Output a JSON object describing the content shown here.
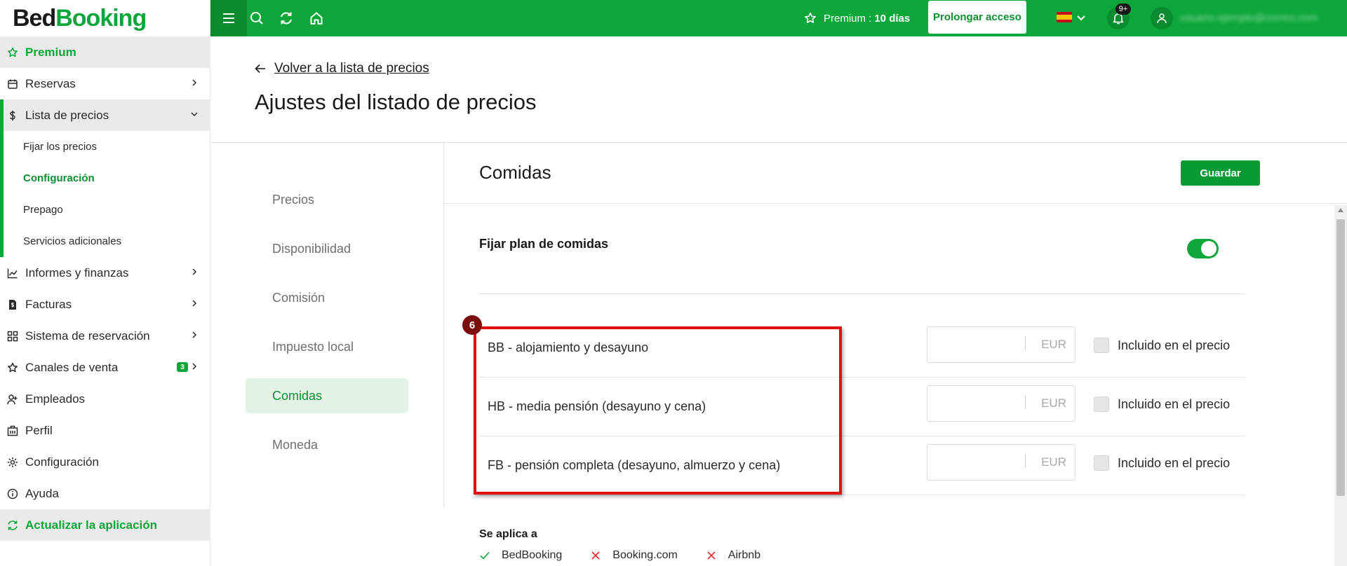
{
  "logo": {
    "part1": "Bed",
    "part2": "Booking"
  },
  "sidebar": {
    "premium": "Premium",
    "items": [
      {
        "label": "Reservas",
        "icon": "calendar-icon"
      },
      {
        "label": "Lista de precios",
        "icon": "dollar-icon"
      },
      {
        "label": "Informes y finanzas",
        "icon": "chart-icon"
      },
      {
        "label": "Facturas",
        "icon": "invoice-icon"
      },
      {
        "label": "Sistema de reservación",
        "icon": "grid-icon"
      },
      {
        "label": "Canales de venta",
        "icon": "star-icon",
        "badge": "3"
      },
      {
        "label": "Empleados",
        "icon": "user-plus-icon"
      },
      {
        "label": "Perfil",
        "icon": "building-icon"
      },
      {
        "label": "Configuración",
        "icon": "gear-icon"
      },
      {
        "label": "Ayuda",
        "icon": "info-icon"
      }
    ],
    "subitems": [
      {
        "label": "Fijar los precios"
      },
      {
        "label": "Configuración"
      },
      {
        "label": "Prepago"
      },
      {
        "label": "Servicios adicionales"
      }
    ],
    "update": "Actualizar la aplicación"
  },
  "topbar": {
    "premium_label": "Premium :",
    "premium_days": "10 días",
    "prolong": "Prolongar acceso",
    "notif_count": "9+",
    "user_email": "usuario.ejemplo@correo.com"
  },
  "header": {
    "back": "Volver a la lista de precios",
    "title": "Ajustes del listado de precios"
  },
  "tabs": [
    {
      "label": "Precios"
    },
    {
      "label": "Disponibilidad"
    },
    {
      "label": "Comisión"
    },
    {
      "label": "Impuesto local"
    },
    {
      "label": "Comidas",
      "active": true
    },
    {
      "label": "Moneda"
    }
  ],
  "main": {
    "title": "Comidas",
    "save": "Guardar",
    "meal_plan_label": "Fijar plan de comidas",
    "meal_plan_enabled": true,
    "step_number": "6",
    "meals": [
      {
        "name": "BB - alojamiento y desayuno",
        "currency": "EUR",
        "included_label": "Incluido en el precio",
        "value": ""
      },
      {
        "name": "HB - media pensión (desayuno y cena)",
        "currency": "EUR",
        "included_label": "Incluido en el precio",
        "value": ""
      },
      {
        "name": "FB - pensión completa (desayuno, almuerzo y cena)",
        "currency": "EUR",
        "included_label": "Incluido en el precio",
        "value": ""
      }
    ],
    "applies_to": "Se aplica a",
    "channels": [
      {
        "name": "BedBooking",
        "status": "check"
      },
      {
        "name": "Booking.com",
        "status": "cross"
      },
      {
        "name": "Airbnb",
        "status": "cross"
      }
    ]
  },
  "colors": {
    "brand_green": "#0ca63a",
    "highlight_red": "#e01010"
  }
}
